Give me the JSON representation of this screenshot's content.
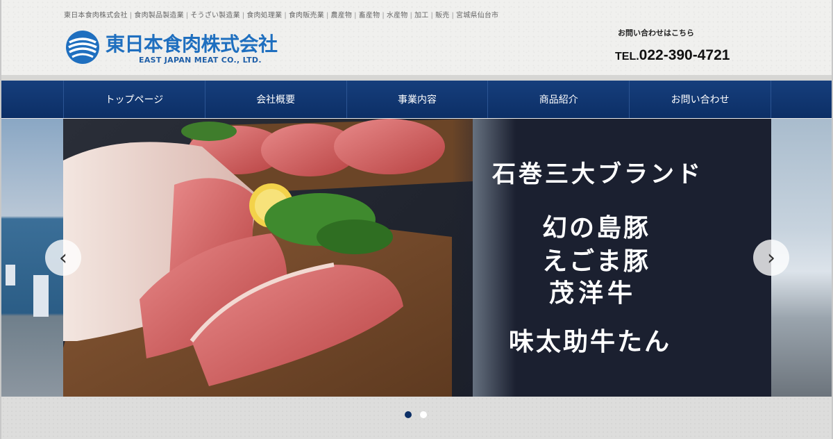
{
  "header": {
    "tagline": [
      "東日本食肉株式会社",
      "食肉製品製造業",
      "そうざい製造業",
      "食肉処理業",
      "食肉販売業",
      "農産物",
      "畜産物",
      "水産物",
      "加工",
      "販売",
      "宮城県仙台市"
    ],
    "tagline_separator": "|",
    "logo_jp": "東日本食肉株式会社",
    "logo_en": "EAST JAPAN MEAT CO., LTD.",
    "contact_label": "お問い合わせはこちら",
    "tel_prefix": "TEL.",
    "tel_number": "022-390-4721"
  },
  "nav": {
    "items": [
      {
        "label": "トップページ"
      },
      {
        "label": "会社概要"
      },
      {
        "label": "事業内容"
      },
      {
        "label": "商品紹介"
      },
      {
        "label": "お問い合わせ"
      }
    ]
  },
  "slider": {
    "heading": "石巻三大ブランド",
    "brands": [
      "幻の島豚",
      "えごま豚",
      "茂洋牛"
    ],
    "extra": "味太助牛たん",
    "prev_symbol": "‹",
    "next_symbol": "›",
    "slide_count": 2,
    "active_slide": 1
  },
  "colors": {
    "nav_bg": "#0c2f66",
    "logo_blue": "#1f6fbf",
    "active_dot": "#0c2f66"
  }
}
